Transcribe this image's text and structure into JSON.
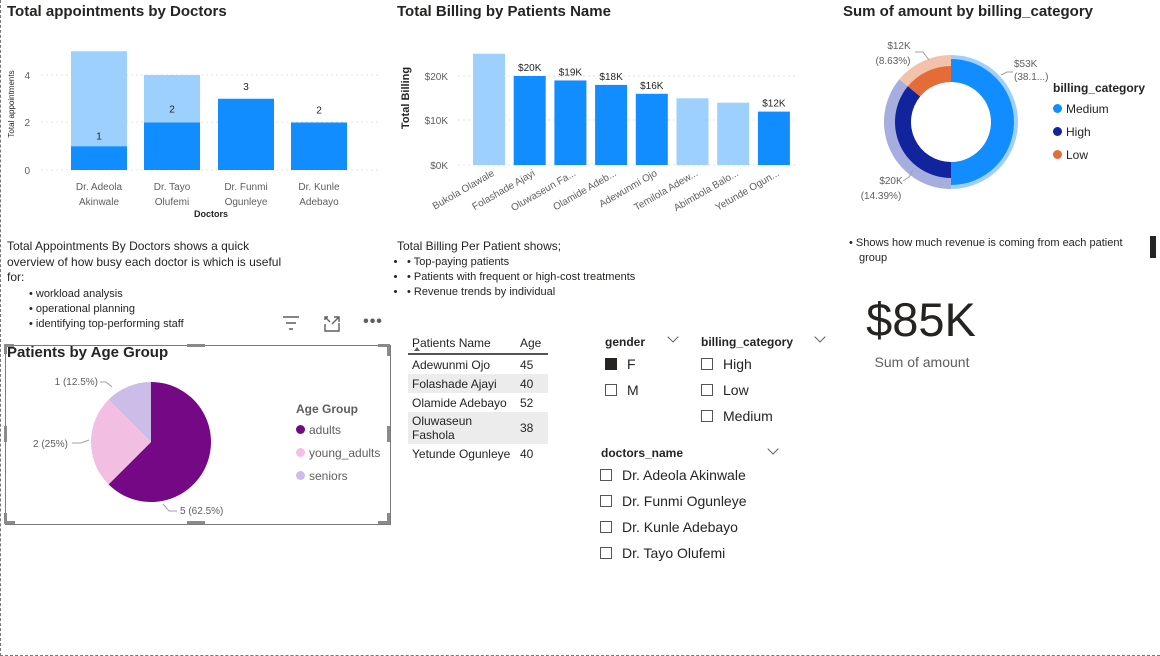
{
  "appointments": {
    "title": "Total appointments by Doctors",
    "ylabel": "Total appointments",
    "xlabel": "Doctors",
    "yticks": [
      "4",
      "2",
      "0"
    ],
    "doctors": [
      {
        "line1": "Dr. Adeola",
        "line2": "Akinwale",
        "label": "1"
      },
      {
        "line1": "Dr. Tayo",
        "line2": "Olufemi",
        "label": "2"
      },
      {
        "line1": "Dr. Funmi",
        "line2": "Ogunleye",
        "label": "3"
      },
      {
        "line1": "Dr. Kunle",
        "line2": "Adebayo",
        "label": "2"
      }
    ],
    "note_intro": "Total Appointments By Doctors shows a quick overview of how busy each doctor is which is useful for:",
    "note_items": [
      "workload analysis",
      "operational planning",
      "identifying top-performing staff"
    ]
  },
  "billing": {
    "title": "Total Billing by Patients Name",
    "ylabel": "Total Billing",
    "yticks": [
      "$20K",
      "$10K",
      "$0K"
    ],
    "bar_labels": [
      "",
      "$20K",
      "$19K",
      "$18K",
      "$16K",
      "",
      "",
      "$12K"
    ],
    "names": [
      "Bukola Olawale",
      "Folashade Ajayi",
      "Oluwaseun Fa...",
      "Olamide Adeb...",
      "Adewunmi Ojo",
      "Temilola Adew...",
      "Abimbola Balo...",
      "Yetunde Ogun..."
    ],
    "note_intro": "Total Billing Per Patient shows;",
    "note_items": [
      "Top-paying patients",
      "Patients with frequent or high-cost treatments",
      "Revenue trends by individual"
    ]
  },
  "category": {
    "title": "Sum of amount by billing_category",
    "legend_title": "billing_category",
    "legend": [
      "Medium",
      "High",
      "Low"
    ],
    "labels": {
      "medium_amt": "$53K",
      "medium_pct": "(38.1...)",
      "low_amt": "$12K",
      "low_pct": "(8.63%)",
      "high_amt": "$20K",
      "high_pct": "(14.39%)"
    },
    "note": "Shows how much revenue is coming from each patient group"
  },
  "card": {
    "value": "$85K",
    "label": "Sum of amount"
  },
  "age": {
    "title": "Patients by Age Group",
    "legend_title": "Age Group",
    "legend": [
      "adults",
      "young_adults",
      "seniors"
    ],
    "labels": {
      "seniors": "1 (12.5%)",
      "young": "2 (25%)",
      "adults": "5 (62.5%)"
    }
  },
  "table": {
    "headers": [
      "Patients Name",
      "Age"
    ],
    "rows": [
      {
        "name": "Adewunmi Ojo",
        "age": "45"
      },
      {
        "name": "Folashade Ajayi",
        "age": "40"
      },
      {
        "name": "Olamide Adebayo",
        "age": "52"
      },
      {
        "name": "Oluwaseun Fashola",
        "age": "38"
      },
      {
        "name": "Yetunde Ogunleye",
        "age": "40"
      }
    ]
  },
  "slicers": {
    "gender": {
      "title": "gender",
      "options": [
        "F",
        "M"
      ]
    },
    "billing": {
      "title": "billing_category",
      "options": [
        "High",
        "Low",
        "Medium"
      ]
    },
    "doctors": {
      "title": "doctors_name",
      "options": [
        "Dr. Adeola Akinwale",
        "Dr. Funmi Ogunleye",
        "Dr. Kunle Adebayo",
        "Dr. Tayo Olufemi"
      ]
    }
  },
  "colors": {
    "bar_dark": "#118dff",
    "bar_light": "#9ed0fd",
    "high": "#12239e",
    "low": "#e66c37",
    "adults": "#750985",
    "young_adults": "#f2bee2",
    "seniors": "#cbbde8"
  },
  "chart_data": [
    {
      "type": "bar",
      "title": "Total appointments by Doctors",
      "xlabel": "Doctors",
      "ylabel": "Total appointments",
      "categories": [
        "Dr. Adeola Akinwale",
        "Dr. Tayo Olufemi",
        "Dr. Funmi Ogunleye",
        "Dr. Kunle Adebayo"
      ],
      "values": [
        1,
        2,
        3,
        2
      ],
      "highlight_totals": [
        5,
        4,
        3,
        2
      ],
      "ylim": [
        0,
        5
      ]
    },
    {
      "type": "bar",
      "title": "Total Billing by Patients Name",
      "ylabel": "Total Billing",
      "categories": [
        "Bukola Olawale",
        "Folashade Ajayi",
        "Oluwaseun Fa...",
        "Olamide Adeb...",
        "Adewunmi Ojo",
        "Temilola Adew...",
        "Abimbola Balo...",
        "Yetunde Ogun..."
      ],
      "values": [
        25000,
        20000,
        19000,
        18000,
        16000,
        15000,
        14000,
        12000
      ],
      "selected": [
        false,
        true,
        true,
        true,
        true,
        false,
        false,
        true
      ],
      "ylim": [
        0,
        26000
      ]
    },
    {
      "type": "pie",
      "title": "Sum of amount by billing_category",
      "categories": [
        "Medium",
        "High",
        "Low"
      ],
      "values": [
        53000,
        20000,
        12000
      ]
    },
    {
      "type": "pie",
      "title": "Patients by Age Group",
      "categories": [
        "adults",
        "young_adults",
        "seniors"
      ],
      "values": [
        5,
        2,
        1
      ]
    }
  ]
}
